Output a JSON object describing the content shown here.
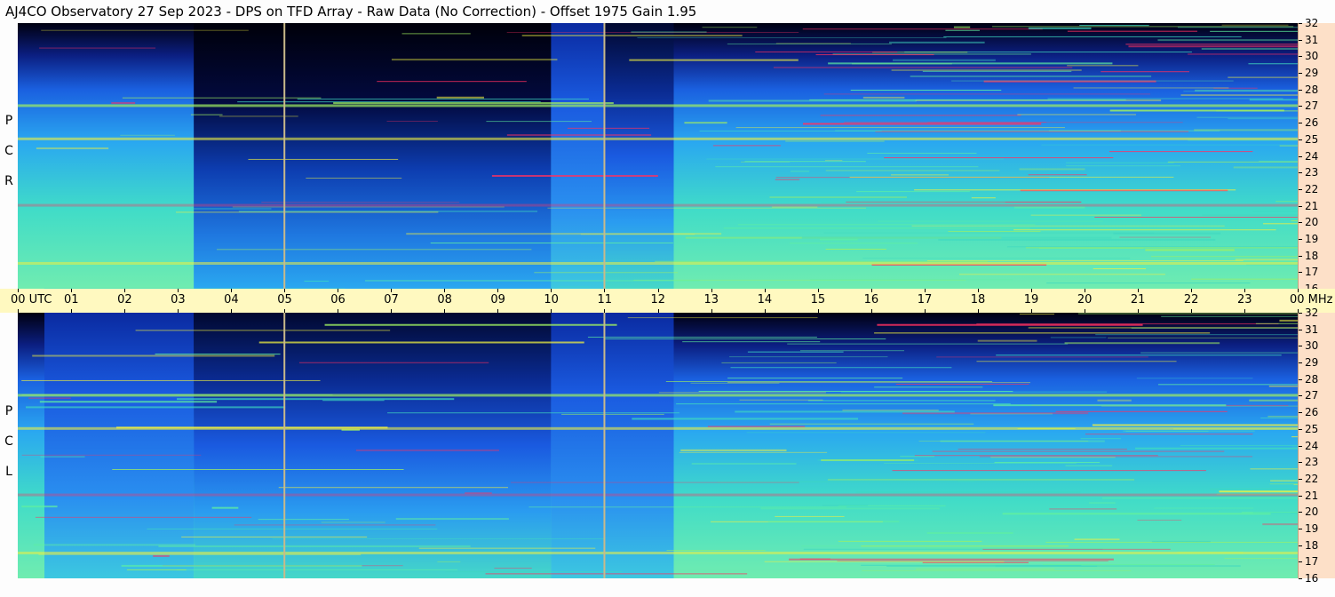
{
  "title": "AJ4CO Observatory  27 Sep 2023  -  DPS on TFD Array  -  Raw Data (No Correction)  -  Offset 1975  Gain 1.95",
  "panels": [
    {
      "id": "rcp",
      "letters": [
        "R",
        "C",
        "P"
      ]
    },
    {
      "id": "lcp",
      "letters": [
        "L",
        "C",
        "P"
      ]
    }
  ],
  "colors": {
    "background": "#fdfdfd",
    "time_axis_bg": "#fff9c0",
    "freq_axis_bg": "#fde0c8",
    "marker_line": "#c9b98a"
  },
  "chart_data": {
    "type": "heatmap",
    "title": "AJ4CO Observatory  27 Sep 2023  -  DPS on TFD Array  -  Raw Data (No Correction)  -  Offset 1975  Gain 1.95",
    "x_axis": {
      "unit_label": "UTC",
      "ticks": [
        "00",
        "01",
        "02",
        "03",
        "04",
        "05",
        "06",
        "07",
        "08",
        "09",
        "10",
        "11",
        "12",
        "13",
        "14",
        "15",
        "16",
        "17",
        "18",
        "19",
        "20",
        "21",
        "22",
        "23",
        "00"
      ],
      "range": [
        0,
        24
      ]
    },
    "y_axis": {
      "unit_label": "MHz",
      "ticks": [
        "16",
        "17",
        "18",
        "19",
        "20",
        "21",
        "22",
        "23",
        "24",
        "25",
        "26",
        "27",
        "28",
        "29",
        "30",
        "31",
        "32"
      ],
      "range": [
        16,
        32
      ]
    },
    "series": [
      {
        "name": "RCP"
      },
      {
        "name": "LCP"
      }
    ],
    "marker_lines_utc": [
      5.0,
      11.0
    ],
    "colormap": [
      "#000010",
      "#0a1a8a",
      "#1a5ae0",
      "#2aa0f0",
      "#3fd8c0",
      "#a0f060",
      "#f0f040",
      "#ff3060"
    ]
  }
}
